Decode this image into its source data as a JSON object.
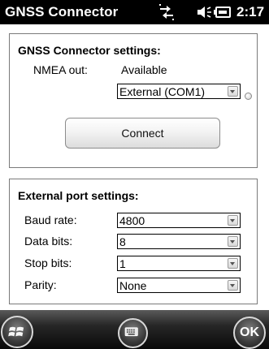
{
  "titlebar": {
    "title": "GNSS Connector",
    "time": "2:17",
    "icons": [
      "connectivity-icon",
      "volume-icon",
      "battery-icon"
    ]
  },
  "connector_settings": {
    "title": "GNSS Connector settings:",
    "nmea_label": "NMEA out:",
    "nmea_status": "Available",
    "port_value": "External (COM1)",
    "connect_label": "Connect"
  },
  "port_settings": {
    "title": "External port settings:",
    "baud_label": "Baud rate:",
    "baud_value": "4800",
    "databits_label": "Data bits:",
    "databits_value": "8",
    "stopbits_label": "Stop bits:",
    "stopbits_value": "1",
    "parity_label": "Parity:",
    "parity_value": "None"
  },
  "softkeys": {
    "ok_label": "OK"
  },
  "colors": {
    "titlebar": "#000000",
    "softbar": "#1a1a1a",
    "border": "#7a7a7a"
  }
}
